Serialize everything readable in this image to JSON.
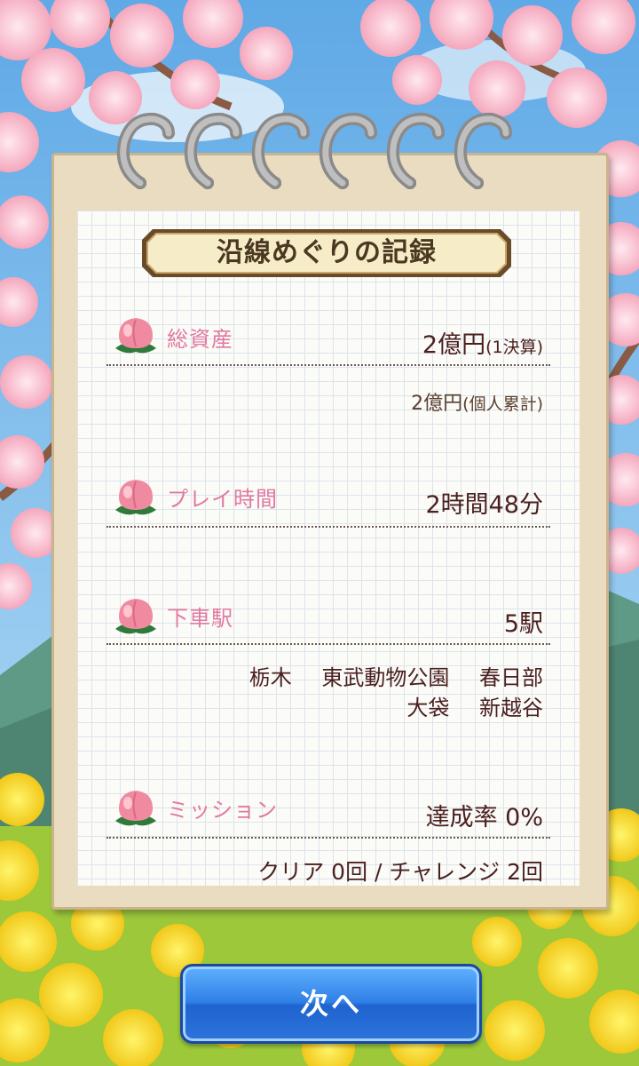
{
  "title": "沿線めぐりの記録",
  "rows": {
    "assets": {
      "label": "総資産",
      "value": "2億円",
      "value_note": "(1決算)",
      "sub_value": "2億円",
      "sub_note": "(個人累計)"
    },
    "playtime": {
      "label": "プレイ時間",
      "value": "2時間48分"
    },
    "stations": {
      "label": "下車駅",
      "value": "5駅",
      "names_line1": [
        "栃木",
        "東武動物公園",
        "春日部"
      ],
      "names_line2": [
        "大袋",
        "新越谷"
      ]
    },
    "mission": {
      "label": "ミッション",
      "value": "達成率 0%",
      "detail": "クリア 0回 / チャレンジ 2回"
    }
  },
  "next_button": "次へ",
  "colors": {
    "label_pink": "#e07aa0",
    "value_dark": "#4a1f1f",
    "button_blue": "#2f7fe6",
    "paper": "#fbfbf8"
  },
  "icons": [
    "peach-icon",
    "cherry-blossom",
    "rapeseed-flower"
  ]
}
